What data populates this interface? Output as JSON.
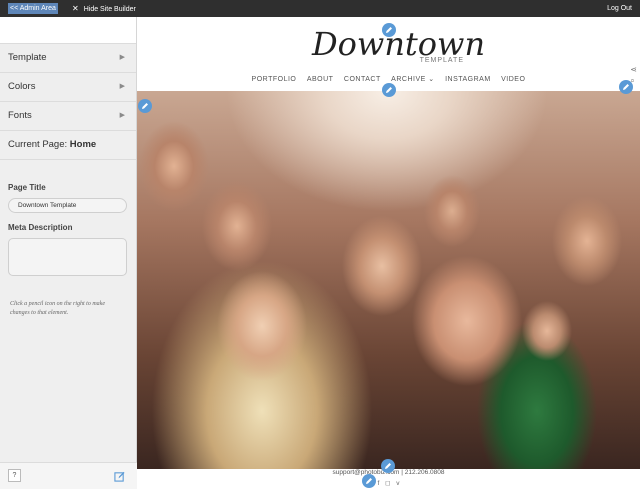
{
  "topbar": {
    "admin_link": "<< Admin Area",
    "hide_builder": "Hide Site Builder",
    "logout": "Log Out"
  },
  "sidebar": {
    "menu": [
      {
        "label": "Template"
      },
      {
        "label": "Colors"
      },
      {
        "label": "Fonts"
      }
    ],
    "current_page_prefix": "Current Page:",
    "current_page_name": "Home",
    "page_title_label": "Page Title",
    "page_title_value": "Downtown Template",
    "meta_label": "Meta Description",
    "meta_value": "",
    "hint": "Click a pencil icon on the right to make changes to that element.",
    "help_label": "?"
  },
  "site": {
    "logo_text": "Downtown",
    "logo_subtext": "TEMPLATE",
    "nav": [
      "PORTFOLIO",
      "ABOUT",
      "CONTACT",
      "ARCHIVE",
      "INSTAGRAM",
      "VIDEO"
    ],
    "footer": "support@photobiz.com | 212.206.0808",
    "social_icons": [
      "facebook-icon",
      "instagram-icon",
      "vimeo-icon"
    ]
  },
  "colors": {
    "topbar_bg": "#2f2f2f",
    "admin_highlight": "#5e86b8",
    "pencil_blue": "#5a9ad6",
    "sidebar_bg": "#efefef"
  }
}
